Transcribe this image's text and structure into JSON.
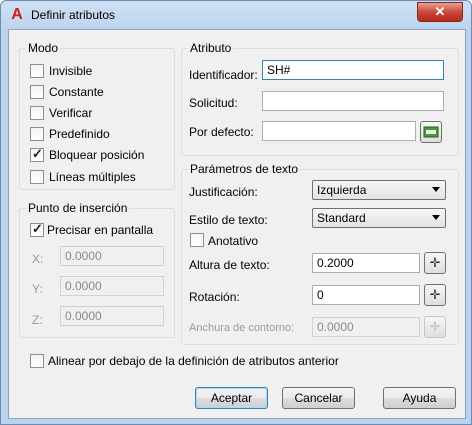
{
  "window": {
    "title": "Definir atributos",
    "close_glyph": "✕",
    "app_icon": "A"
  },
  "modo": {
    "title": "Modo",
    "items": [
      {
        "label": "Invisible",
        "checked": false
      },
      {
        "label": "Constante",
        "checked": false
      },
      {
        "label": "Verificar",
        "checked": false
      },
      {
        "label": "Predefinido",
        "checked": false
      },
      {
        "label": "Bloquear posición",
        "checked": true
      },
      {
        "label": "Líneas múltiples",
        "checked": false
      }
    ]
  },
  "insercion": {
    "title": "Punto de inserción",
    "precisar_label": "Precisar en pantalla",
    "precisar_checked": true,
    "x_label": "X:",
    "x_value": "0.0000",
    "y_label": "Y:",
    "y_value": "0.0000",
    "z_label": "Z:",
    "z_value": "0.0000"
  },
  "atributo": {
    "title": "Atributo",
    "identificador_label": "Identificador:",
    "identificador_value": "SH#",
    "solicitud_label": "Solicitud:",
    "solicitud_value": "",
    "defecto_label": "Por defecto:",
    "defecto_value": ""
  },
  "texto": {
    "title": "Parámetros de texto",
    "justificacion_label": "Justificación:",
    "justificacion_value": "Izquierda",
    "estilo_label": "Estilo de texto:",
    "estilo_value": "Standard",
    "anotativo_label": "Anotativo",
    "anotativo_checked": false,
    "altura_label": "Altura de texto:",
    "altura_value": "0.2000",
    "rotacion_label": "Rotación:",
    "rotacion_value": "0",
    "anchura_label": "Anchura de contorno:",
    "anchura_value": "0.0000"
  },
  "alinear": {
    "label": "Alinear por debajo de la definición de atributos anterior",
    "checked": false
  },
  "buttons": {
    "accept": "Aceptar",
    "cancel": "Cancelar",
    "help": "Ayuda"
  },
  "icons": {
    "pick": "crosshair-icon",
    "field": "insert-field-icon"
  }
}
